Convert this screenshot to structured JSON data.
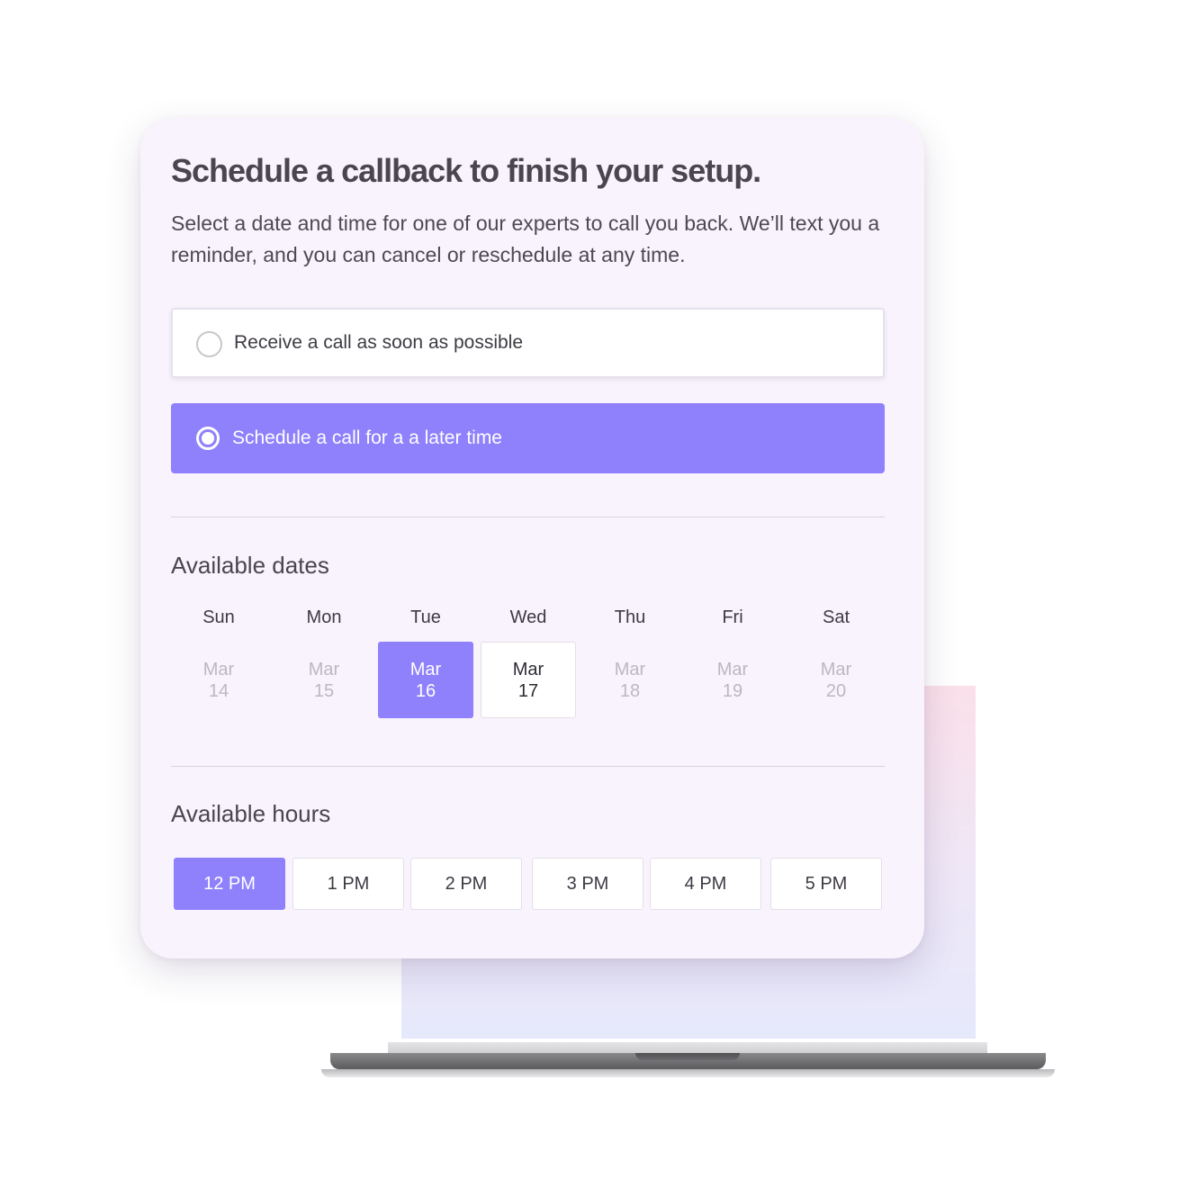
{
  "card": {
    "title": "Schedule a callback to finish your setup.",
    "description": "Select a date and time for one of our experts to call you back. We’ll text you a reminder, and you can cancel or reschedule at any time."
  },
  "options": {
    "asap": {
      "label": "Receive a call as soon as possible",
      "selected": false
    },
    "later": {
      "label": "Schedule a call for a a later time",
      "selected": true
    }
  },
  "dates": {
    "title": "Available dates",
    "days": [
      {
        "dow": "Sun",
        "month": "Mar",
        "day": "14",
        "state": "disabled"
      },
      {
        "dow": "Mon",
        "month": "Mar",
        "day": "15",
        "state": "disabled"
      },
      {
        "dow": "Tue",
        "month": "Mar",
        "day": "16",
        "state": "selected"
      },
      {
        "dow": "Wed",
        "month": "Mar",
        "day": "17",
        "state": "available"
      },
      {
        "dow": "Thu",
        "month": "Mar",
        "day": "18",
        "state": "disabled"
      },
      {
        "dow": "Fri",
        "month": "Mar",
        "day": "19",
        "state": "disabled"
      },
      {
        "dow": "Sat",
        "month": "Mar",
        "day": "20",
        "state": "disabled"
      }
    ]
  },
  "hours": {
    "title": "Available hours",
    "slots": [
      {
        "label": "12 PM",
        "selected": true
      },
      {
        "label": "1 PM",
        "selected": false
      },
      {
        "label": "2 PM",
        "selected": false
      },
      {
        "label": "3 PM",
        "selected": false
      },
      {
        "label": "4 PM",
        "selected": false
      },
      {
        "label": "5 PM",
        "selected": false
      }
    ]
  },
  "colors": {
    "accent": "#8f80fb",
    "card_background": "#f8f3fd",
    "heading_text": "#4a4550"
  }
}
